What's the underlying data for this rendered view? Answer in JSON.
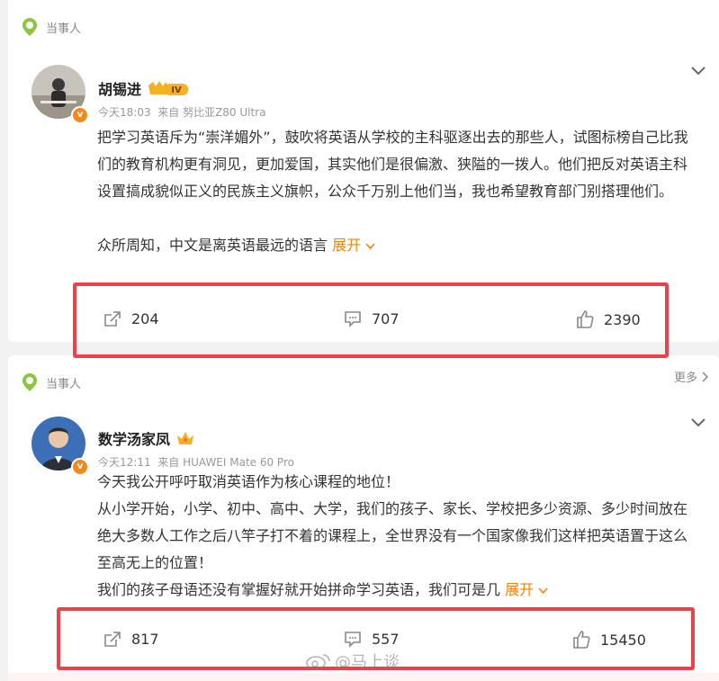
{
  "posts": [
    {
      "tag": "当事人",
      "author": "胡锡进",
      "level_badge": "IV",
      "time": "今天18:03",
      "source_prefix": "来自",
      "source": "努比亚Z80 Ultra",
      "paragraphs": [
        "把学习英语斥为“崇洋媚外”，鼓吹将英语从学校的主科驱逐出去的那些人，试图标榜自己比我们的教育机构更有洞见，更加爱国，其实他们是很偏激、狭隘的一拨人。他们把反对英语主科设置搞成貌似正义的民族主义旗帜，公众千万别上他们当，我也希望教育部门别搭理他们。",
        "众所周知，中文是离英语最远的语言"
      ],
      "expand_label": "展开",
      "reposts": "204",
      "comments": "707",
      "likes": "2390"
    },
    {
      "tag": "当事人",
      "more_label": "更多",
      "author": "数学汤家凤",
      "time": "今天12:11",
      "source_prefix": "来自",
      "source": "HUAWEI Mate 60 Pro",
      "paragraphs": [
        "今天我公开呼吁取消英语作为核心课程的地位！",
        "从小学开始，小学、初中、高中、大学，我们的孩子、家长、学校把多少资源、多少时间放在绝大多数人工作之后八竿子打不着的课程上，全世界没有一个国家像我们这样把英语置于这么至高无上的位置！",
        "我们的孩子母语还没有掌握好就开始拼命学习英语，我们可是几"
      ],
      "expand_label": "展开",
      "reposts": "817",
      "comments": "557",
      "likes": "15450"
    }
  ],
  "watermark": "@马上谈",
  "colors": {
    "accent": "#ff8200",
    "highlight_box": "#e8434a",
    "tag_icon": "#7bbf3a",
    "verified": "#f08a1a"
  }
}
